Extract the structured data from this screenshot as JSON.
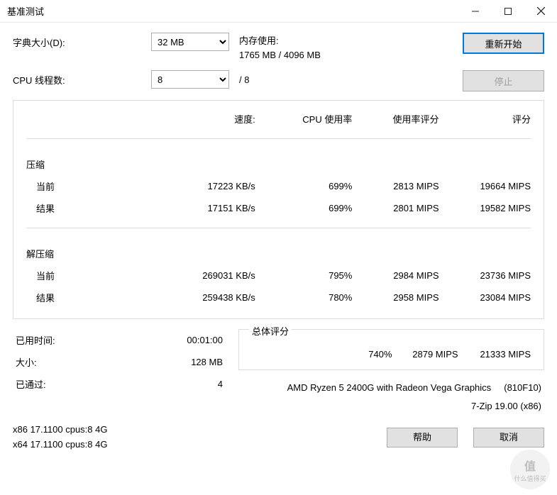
{
  "window": {
    "title": "基准测试"
  },
  "controls": {
    "dict_size_label": "字典大小(D):",
    "dict_size_value": "32 MB",
    "threads_label": "CPU 线程数:",
    "threads_value": "8",
    "threads_max": "/ 8",
    "mem_label": "内存使用:",
    "mem_value": "1765 MB / 4096 MB",
    "restart_btn": "重新开始",
    "stop_btn": "停止"
  },
  "headers": {
    "speed": "速度:",
    "cpu_usage": "CPU 使用率",
    "usage_rating": "使用率评分",
    "rating": "评分"
  },
  "compress": {
    "title": "压缩",
    "current_label": "当前",
    "current": {
      "speed": "17223 KB/s",
      "cpu": "699%",
      "usage_rating": "2813 MIPS",
      "rating": "19664 MIPS"
    },
    "result_label": "结果",
    "result": {
      "speed": "17151 KB/s",
      "cpu": "699%",
      "usage_rating": "2801 MIPS",
      "rating": "19582 MIPS"
    }
  },
  "decompress": {
    "title": "解压缩",
    "current_label": "当前",
    "current": {
      "speed": "269031 KB/s",
      "cpu": "795%",
      "usage_rating": "2984 MIPS",
      "rating": "23736 MIPS"
    },
    "result_label": "结果",
    "result": {
      "speed": "259438 KB/s",
      "cpu": "780%",
      "usage_rating": "2958 MIPS",
      "rating": "23084 MIPS"
    }
  },
  "summary": {
    "elapsed_label": "已用时间:",
    "elapsed": "00:01:00",
    "size_label": "大小:",
    "size": "128 MB",
    "passed_label": "已通过:",
    "passed": "4"
  },
  "overall": {
    "title": "总体评分",
    "cpu": "740%",
    "usage_rating": "2879 MIPS",
    "rating": "21333 MIPS"
  },
  "system": {
    "cpu_name": "AMD Ryzen 5 2400G with Radeon Vega Graphics",
    "cpu_id": "(810F10)",
    "app": "7-Zip 19.00 (x86)",
    "line1": "x86 17.1100 cpus:8 4G",
    "line2": "x64 17.1100 cpus:8 4G"
  },
  "footer": {
    "help": "帮助",
    "cancel": "取消"
  },
  "watermark": {
    "main": "值",
    "sub": "什么值得买"
  }
}
